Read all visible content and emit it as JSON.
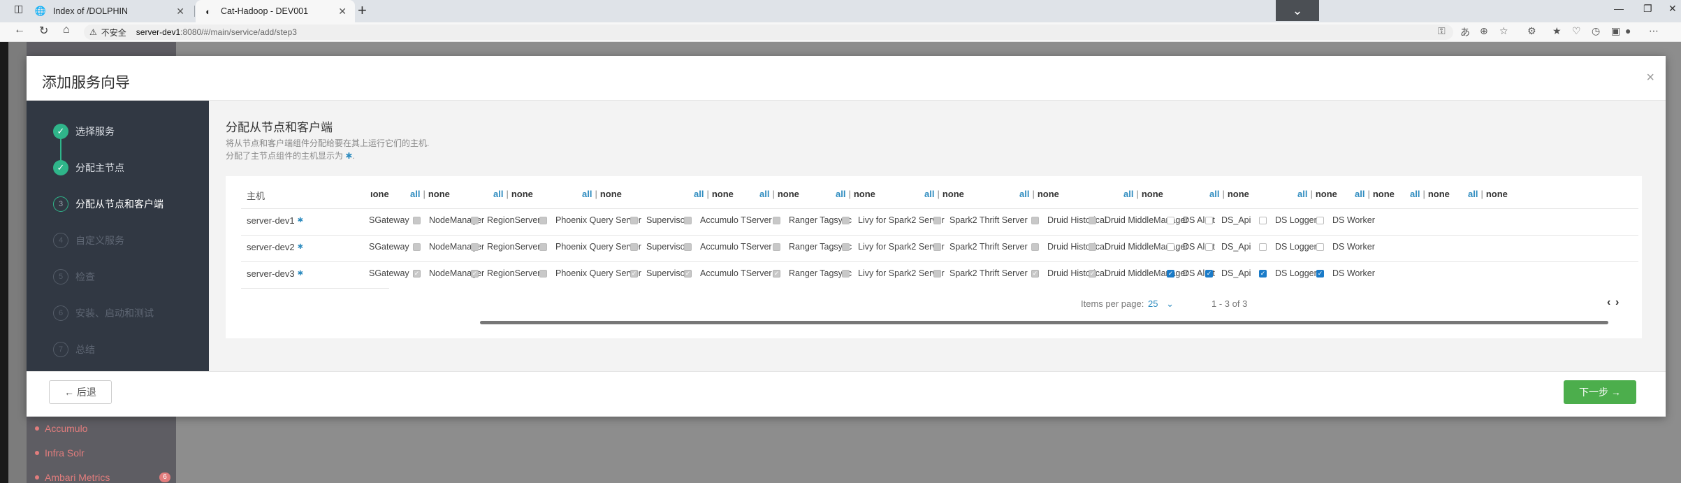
{
  "browser": {
    "tabs": [
      {
        "title": "Index of /DOLPHIN",
        "icon": "globe-icon"
      },
      {
        "title": "Cat-Hadoop - DEV001",
        "icon": "browser-icon"
      }
    ],
    "url_warning": "不安全",
    "url_host": "server-dev1",
    "url_path": ":8080/#/main/service/add/step3"
  },
  "bg_sidebar": {
    "items": [
      "Accumulo",
      "Infra Solr",
      "Ambari Metrics"
    ],
    "badge": "6"
  },
  "modal": {
    "title": "添加服务向导",
    "close": "×",
    "steps": [
      {
        "num": "✓",
        "label": "选择服务",
        "state": "done"
      },
      {
        "num": "✓",
        "label": "分配主节点",
        "state": "done"
      },
      {
        "num": "3",
        "label": "分配从节点和客户端",
        "state": "current"
      },
      {
        "num": "4",
        "label": "自定义服务",
        "state": "todo"
      },
      {
        "num": "5",
        "label": "检查",
        "state": "todo"
      },
      {
        "num": "6",
        "label": "安装、启动和测试",
        "state": "todo"
      },
      {
        "num": "7",
        "label": "总结",
        "state": "todo"
      }
    ],
    "content": {
      "title": "分配从节点和客户端",
      "desc_line1": "将从节点和客户端组件分配给要在其上运行它们的主机.",
      "desc_line2": "分配了主节点组件的主机显示为",
      "desc_star": "✱",
      "desc_end": "."
    },
    "table": {
      "host_header": "主机",
      "all_label": "all",
      "none_label": "none",
      "sep": "|",
      "partial_none": "ıone",
      "columns": [
        "SGateway",
        "NodeManager",
        "RegionServer",
        "Phoenix Query Server",
        "Supervisor",
        "Accumulo TServer",
        "Ranger Tagsync",
        "Livy for Spark2 Server",
        "Spark2 Thrift Server",
        "Druid Historical",
        "Druid MiddleManager",
        "DS Alert",
        "DS_Api",
        "DS Logger",
        "DS Worker"
      ],
      "rows": [
        {
          "host": "server-dev1",
          "states": [
            "none",
            "disabled",
            "disabled",
            "disabled",
            "disabled",
            "disabled",
            "disabled",
            "disabled",
            "disabled",
            "disabled",
            "disabled",
            "empty",
            "empty",
            "empty",
            "empty"
          ]
        },
        {
          "host": "server-dev2",
          "states": [
            "none",
            "disabled",
            "disabled",
            "disabled",
            "disabled",
            "disabled",
            "disabled",
            "disabled",
            "disabled",
            "disabled",
            "disabled",
            "empty",
            "empty",
            "empty",
            "empty"
          ]
        },
        {
          "host": "server-dev3",
          "states": [
            "none",
            "disabled-checked",
            "disabled-checked",
            "disabled",
            "disabled-checked",
            "disabled-checked",
            "disabled-checked",
            "disabled",
            "disabled",
            "disabled-checked",
            "disabled-checked",
            "checked",
            "checked",
            "checked",
            "checked"
          ]
        }
      ],
      "items_per_page_label": "Items per page:",
      "items_per_page": "25",
      "range": "1 - 3 of 3"
    },
    "footer": {
      "back": "← 后退",
      "next": "下一步 →"
    }
  }
}
